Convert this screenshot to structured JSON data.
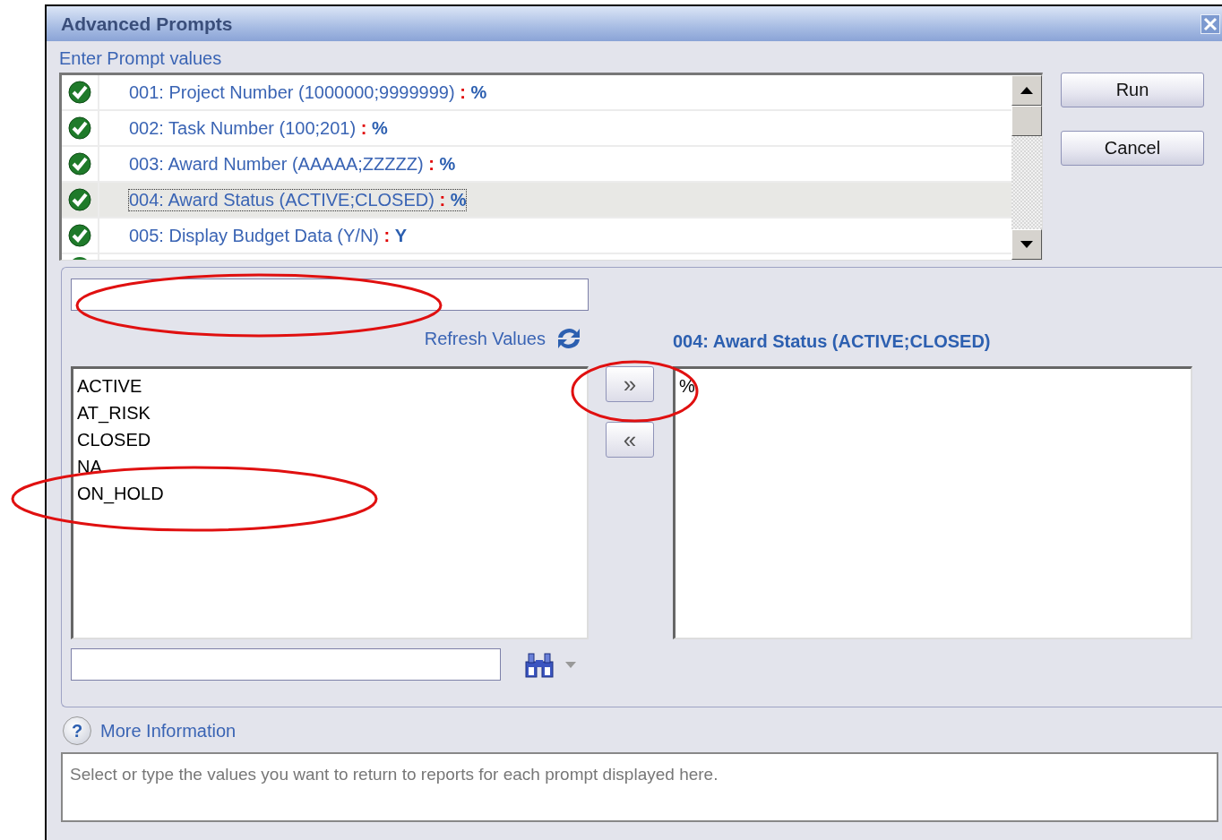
{
  "window": {
    "title": "Advanced Prompts"
  },
  "section_label": "Enter Prompt values",
  "prompts": [
    {
      "label": "001: Project Number (1000000;9999999)",
      "separator": ":",
      "value": "%",
      "complete": true,
      "selected": false
    },
    {
      "label": "002: Task Number (100;201)",
      "separator": ":",
      "value": "%",
      "complete": true,
      "selected": false
    },
    {
      "label": "003: Award Number (AAAAA;ZZZZZ)",
      "separator": ":",
      "value": "%",
      "complete": true,
      "selected": false
    },
    {
      "label": "004: Award Status (ACTIVE;CLOSED)",
      "separator": ":",
      "value": "%",
      "complete": true,
      "selected": true
    },
    {
      "label": "005: Display Budget Data (Y/N)",
      "separator": ":",
      "value": "Y",
      "complete": true,
      "selected": false
    }
  ],
  "buttons": [
    {
      "label": "Run"
    },
    {
      "label": "Cancel"
    }
  ],
  "refresh_link": "Refresh Values",
  "available_values": [
    "ACTIVE",
    "AT_RISK",
    "CLOSED",
    "NA",
    "ON_HOLD"
  ],
  "move_buttons": [
    {
      "label": "»"
    },
    {
      "label": "«"
    }
  ],
  "selected_title": "004: Award Status (ACTIVE;CLOSED)",
  "selected_values": [
    "%"
  ],
  "help": {
    "icon": "?",
    "label": "More Information"
  },
  "description": "Select or type the values you want to return to reports for each prompt displayed here.",
  "annotations": [
    {
      "kind": "ellipse"
    },
    {
      "kind": "ellipse"
    },
    {
      "kind": "ellipse"
    }
  ]
}
